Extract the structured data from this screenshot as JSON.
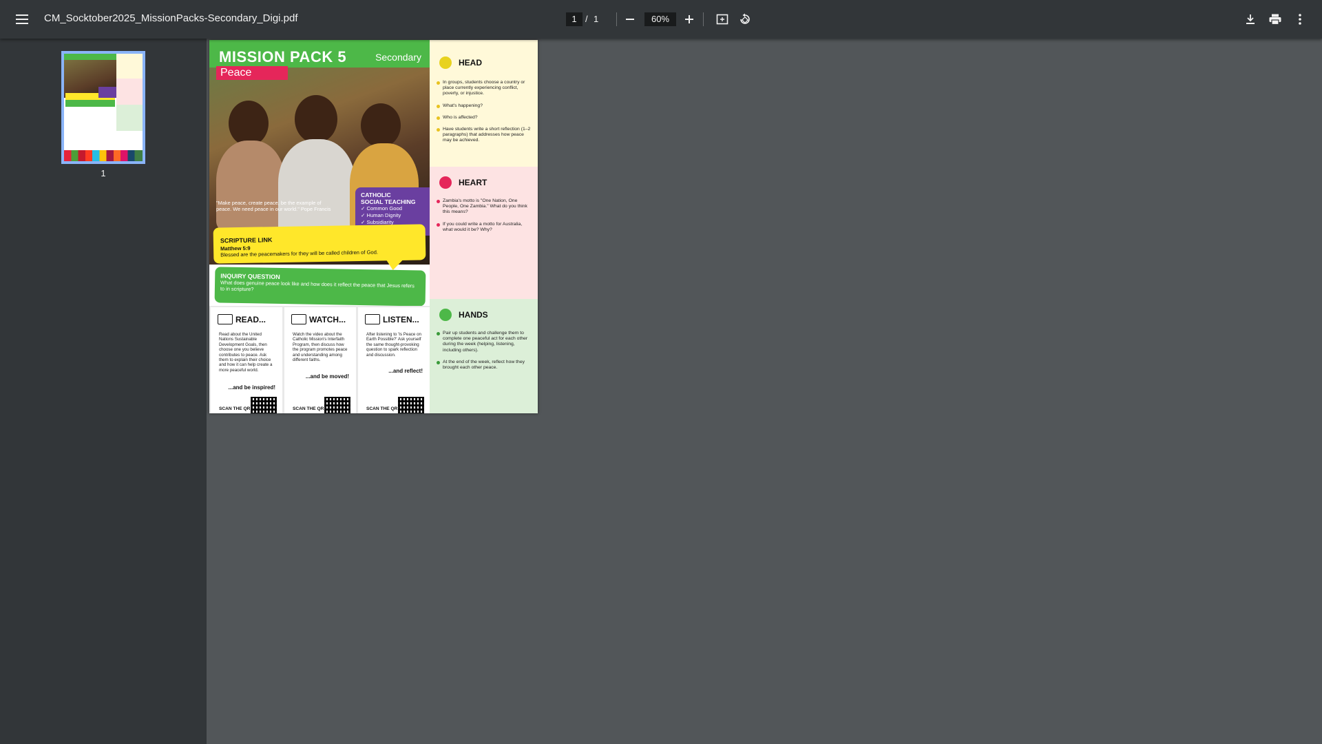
{
  "toolbar": {
    "filename": "CM_Socktober2025_MissionPacks-Secondary_Digi.pdf",
    "current_page": "1",
    "page_separator": "/",
    "total_pages": "1",
    "zoom": "60%"
  },
  "sidebar": {
    "thumbnail_label": "1"
  },
  "document": {
    "title": "MISSION PACK 5",
    "level": "Secondary",
    "theme": "Peace",
    "quote": "\"Make peace, create peace, be the example of peace. We need peace in our world.\" Pope Francis",
    "cst": {
      "title_line1": "CATHOLIC",
      "title_line2": "SOCIAL TEACHING",
      "items": [
        "✓ Common Good",
        "✓ Human Dignity",
        "✓ Subsidiarity"
      ]
    },
    "scripture": {
      "title": "SCRIPTURE LINK",
      "reference": "Matthew 5:9",
      "text": "Blessed are the peacemakers for they will be called children of God."
    },
    "inquiry": {
      "title": "INQUIRY QUESTION",
      "text": "What does genuine peace look like and how does it reflect the peace that Jesus refers to in scripture?"
    },
    "columns": [
      {
        "heading": "READ...",
        "text": "Read about the United Nations Sustainable Development Goals, then choose one you believe contributes to peace. Ask them to explain their choice and how it can help create a more peaceful world.",
        "tagline": "...and be inspired!",
        "scan": "SCAN THE QR CODE"
      },
      {
        "heading": "WATCH...",
        "text": "Watch the video about the Catholic Mission's Interfaith Program, then discuss how the program promotes peace and understanding among different faiths.",
        "tagline": "...and be moved!",
        "scan": "SCAN THE QR CODE"
      },
      {
        "heading": "LISTEN...",
        "text": "After listening to 'Is Peace on Earth Possible?' Ask yourself the same thought-provoking question to spark reflection and discussion.",
        "tagline": "...and reflect!",
        "scan": "SCAN THE QR CODE"
      }
    ],
    "head": {
      "title": "HEAD",
      "items": [
        "In groups, students choose a country or place currently experiencing conflict, poverty, or injustice.",
        "What's happening?",
        "Who is affected?",
        "Have students write a short reflection (1–2 paragraphs) that addresses how peace may be achieved."
      ]
    },
    "heart": {
      "title": "HEART",
      "items": [
        "Zambia's motto is \"One Nation, One People, One Zambia.\" What do you think this means?",
        "If you could write a motto for Australia, what would it be? Why?"
      ]
    },
    "hands": {
      "title": "HANDS",
      "items": [
        "Pair up students and challenge them to complete one peaceful act for each other during the week (helping, listening, including others).",
        "At the end of the week, reflect how they brought each other peace."
      ]
    }
  },
  "colors": {
    "toolbar": "#323639",
    "viewer_bg": "#525659",
    "green": "#4db848",
    "pink": "#e5265a",
    "yellow": "#ffe72a",
    "purple": "#6a3fa0",
    "head_bg": "#fff9d9",
    "heart_bg": "#fde3e3",
    "hands_bg": "#dcefd8"
  }
}
